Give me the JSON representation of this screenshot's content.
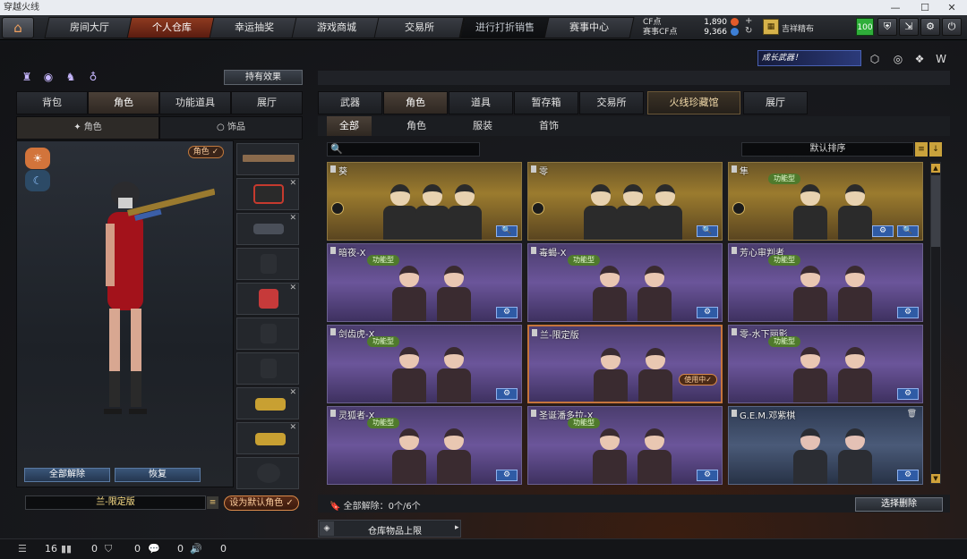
{
  "window": {
    "title": "穿越火线",
    "controls": [
      "—",
      "☐",
      "✕"
    ]
  },
  "topnav": {
    "tabs": [
      "房间大厅",
      "个人仓库",
      "幸运抽奖",
      "游戏商城",
      "交易所",
      "进行打折销售",
      "赛事中心"
    ],
    "active_index": 1,
    "cf_label": "CF点",
    "cf_value": "1,890",
    "match_cf_label": "赛事CF点",
    "match_cf_value": "9,366",
    "rank_name": "吉祥精布",
    "level": "100"
  },
  "left": {
    "effect_button": "持有效果",
    "tabs": [
      "背包",
      "角色",
      "功能道具",
      "展厅"
    ],
    "active_tab": 1,
    "subtabs": [
      "角色",
      "饰品"
    ],
    "role_pill": "角色 ✓",
    "buttons": {
      "unequip_all": "全部解除",
      "restore": "恢复"
    },
    "character_name": "兰-限定版",
    "list_icon": "≡",
    "set_default": "设为默认角色 ✓"
  },
  "right": {
    "banner": "成长武器！",
    "tabs": [
      "武器",
      "角色",
      "道具",
      "暂存箱",
      "交易所",
      "火线珍藏馆",
      "展厅"
    ],
    "active_tab": 1,
    "filters": [
      "全部",
      "角色",
      "服装",
      "首饰"
    ],
    "active_filter": 0,
    "search_icon": "🔍",
    "sort_label": "默认排序",
    "cards": [
      {
        "title": "葵",
        "style": "gold",
        "tag": "",
        "buttons": [
          "🔍"
        ],
        "inuse": ""
      },
      {
        "title": "零",
        "style": "gold",
        "tag": "",
        "buttons": [
          "🔍"
        ],
        "inuse": ""
      },
      {
        "title": "隼",
        "style": "gold",
        "tag": "功能型",
        "buttons": [
          "⚙",
          "🔍"
        ],
        "inuse": ""
      },
      {
        "title": "暗夜-X",
        "style": "purple",
        "tag": "功能型",
        "buttons": [
          "⚙"
        ],
        "inuse": ""
      },
      {
        "title": "毒蝎-X",
        "style": "purple",
        "tag": "功能型",
        "buttons": [
          "⚙"
        ],
        "inuse": ""
      },
      {
        "title": "芳心审判者",
        "style": "purple",
        "tag": "功能型",
        "buttons": [
          "⚙"
        ],
        "inuse": ""
      },
      {
        "title": "剑齿虎-X",
        "style": "purple",
        "tag": "功能型",
        "buttons": [
          "⚙"
        ],
        "inuse": ""
      },
      {
        "title": "兰-限定版",
        "style": "purple",
        "tag": "",
        "buttons": [],
        "inuse": "使用中✓"
      },
      {
        "title": "零-水下丽影",
        "style": "purple",
        "tag": "功能型",
        "buttons": [
          "⚙"
        ],
        "inuse": ""
      },
      {
        "title": "灵狐者-X",
        "style": "purple",
        "tag": "功能型",
        "buttons": [
          "⚙"
        ],
        "inuse": ""
      },
      {
        "title": "圣诞潘多拉-X",
        "style": "purple",
        "tag": "功能型",
        "buttons": [
          "⚙"
        ],
        "inuse": ""
      },
      {
        "title": "G.E.M.邓紫棋",
        "style": "blue",
        "tag": "",
        "buttons": [
          "⚙"
        ],
        "inuse": ""
      }
    ],
    "unlock_count": "全部解除：0个/6个",
    "select_delete": "选择删除",
    "capacity": "仓库物品上限"
  },
  "status": {
    "values": [
      "16",
      "0",
      "0",
      "0",
      "0"
    ]
  },
  "colors": {
    "accent_orange": "#c6743c",
    "active_tab": "#8e3a20",
    "gold_card": "#9b7b2e",
    "purple_card": "#6b559a"
  }
}
